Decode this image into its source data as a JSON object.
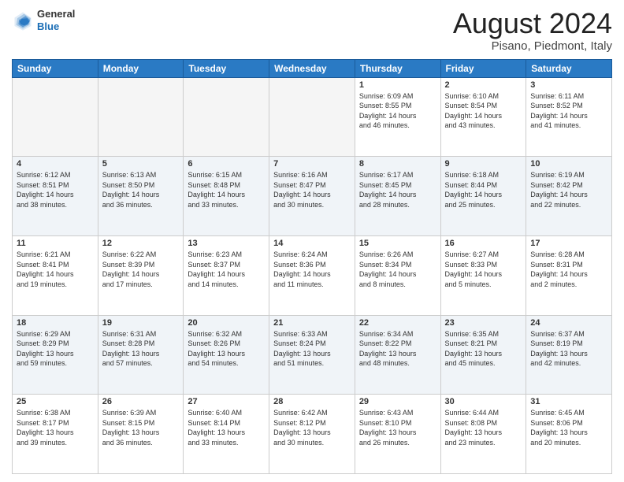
{
  "header": {
    "logo": {
      "general": "General",
      "blue": "Blue"
    },
    "title": "August 2024",
    "location": "Pisano, Piedmont, Italy"
  },
  "weekdays": [
    "Sunday",
    "Monday",
    "Tuesday",
    "Wednesday",
    "Thursday",
    "Friday",
    "Saturday"
  ],
  "weeks": [
    [
      {
        "day": "",
        "info": ""
      },
      {
        "day": "",
        "info": ""
      },
      {
        "day": "",
        "info": ""
      },
      {
        "day": "",
        "info": ""
      },
      {
        "day": "1",
        "info": "Sunrise: 6:09 AM\nSunset: 8:55 PM\nDaylight: 14 hours\nand 46 minutes."
      },
      {
        "day": "2",
        "info": "Sunrise: 6:10 AM\nSunset: 8:54 PM\nDaylight: 14 hours\nand 43 minutes."
      },
      {
        "day": "3",
        "info": "Sunrise: 6:11 AM\nSunset: 8:52 PM\nDaylight: 14 hours\nand 41 minutes."
      }
    ],
    [
      {
        "day": "4",
        "info": "Sunrise: 6:12 AM\nSunset: 8:51 PM\nDaylight: 14 hours\nand 38 minutes."
      },
      {
        "day": "5",
        "info": "Sunrise: 6:13 AM\nSunset: 8:50 PM\nDaylight: 14 hours\nand 36 minutes."
      },
      {
        "day": "6",
        "info": "Sunrise: 6:15 AM\nSunset: 8:48 PM\nDaylight: 14 hours\nand 33 minutes."
      },
      {
        "day": "7",
        "info": "Sunrise: 6:16 AM\nSunset: 8:47 PM\nDaylight: 14 hours\nand 30 minutes."
      },
      {
        "day": "8",
        "info": "Sunrise: 6:17 AM\nSunset: 8:45 PM\nDaylight: 14 hours\nand 28 minutes."
      },
      {
        "day": "9",
        "info": "Sunrise: 6:18 AM\nSunset: 8:44 PM\nDaylight: 14 hours\nand 25 minutes."
      },
      {
        "day": "10",
        "info": "Sunrise: 6:19 AM\nSunset: 8:42 PM\nDaylight: 14 hours\nand 22 minutes."
      }
    ],
    [
      {
        "day": "11",
        "info": "Sunrise: 6:21 AM\nSunset: 8:41 PM\nDaylight: 14 hours\nand 19 minutes."
      },
      {
        "day": "12",
        "info": "Sunrise: 6:22 AM\nSunset: 8:39 PM\nDaylight: 14 hours\nand 17 minutes."
      },
      {
        "day": "13",
        "info": "Sunrise: 6:23 AM\nSunset: 8:37 PM\nDaylight: 14 hours\nand 14 minutes."
      },
      {
        "day": "14",
        "info": "Sunrise: 6:24 AM\nSunset: 8:36 PM\nDaylight: 14 hours\nand 11 minutes."
      },
      {
        "day": "15",
        "info": "Sunrise: 6:26 AM\nSunset: 8:34 PM\nDaylight: 14 hours\nand 8 minutes."
      },
      {
        "day": "16",
        "info": "Sunrise: 6:27 AM\nSunset: 8:33 PM\nDaylight: 14 hours\nand 5 minutes."
      },
      {
        "day": "17",
        "info": "Sunrise: 6:28 AM\nSunset: 8:31 PM\nDaylight: 14 hours\nand 2 minutes."
      }
    ],
    [
      {
        "day": "18",
        "info": "Sunrise: 6:29 AM\nSunset: 8:29 PM\nDaylight: 13 hours\nand 59 minutes."
      },
      {
        "day": "19",
        "info": "Sunrise: 6:31 AM\nSunset: 8:28 PM\nDaylight: 13 hours\nand 57 minutes."
      },
      {
        "day": "20",
        "info": "Sunrise: 6:32 AM\nSunset: 8:26 PM\nDaylight: 13 hours\nand 54 minutes."
      },
      {
        "day": "21",
        "info": "Sunrise: 6:33 AM\nSunset: 8:24 PM\nDaylight: 13 hours\nand 51 minutes."
      },
      {
        "day": "22",
        "info": "Sunrise: 6:34 AM\nSunset: 8:22 PM\nDaylight: 13 hours\nand 48 minutes."
      },
      {
        "day": "23",
        "info": "Sunrise: 6:35 AM\nSunset: 8:21 PM\nDaylight: 13 hours\nand 45 minutes."
      },
      {
        "day": "24",
        "info": "Sunrise: 6:37 AM\nSunset: 8:19 PM\nDaylight: 13 hours\nand 42 minutes."
      }
    ],
    [
      {
        "day": "25",
        "info": "Sunrise: 6:38 AM\nSunset: 8:17 PM\nDaylight: 13 hours\nand 39 minutes."
      },
      {
        "day": "26",
        "info": "Sunrise: 6:39 AM\nSunset: 8:15 PM\nDaylight: 13 hours\nand 36 minutes."
      },
      {
        "day": "27",
        "info": "Sunrise: 6:40 AM\nSunset: 8:14 PM\nDaylight: 13 hours\nand 33 minutes."
      },
      {
        "day": "28",
        "info": "Sunrise: 6:42 AM\nSunset: 8:12 PM\nDaylight: 13 hours\nand 30 minutes."
      },
      {
        "day": "29",
        "info": "Sunrise: 6:43 AM\nSunset: 8:10 PM\nDaylight: 13 hours\nand 26 minutes."
      },
      {
        "day": "30",
        "info": "Sunrise: 6:44 AM\nSunset: 8:08 PM\nDaylight: 13 hours\nand 23 minutes."
      },
      {
        "day": "31",
        "info": "Sunrise: 6:45 AM\nSunset: 8:06 PM\nDaylight: 13 hours\nand 20 minutes."
      }
    ]
  ]
}
